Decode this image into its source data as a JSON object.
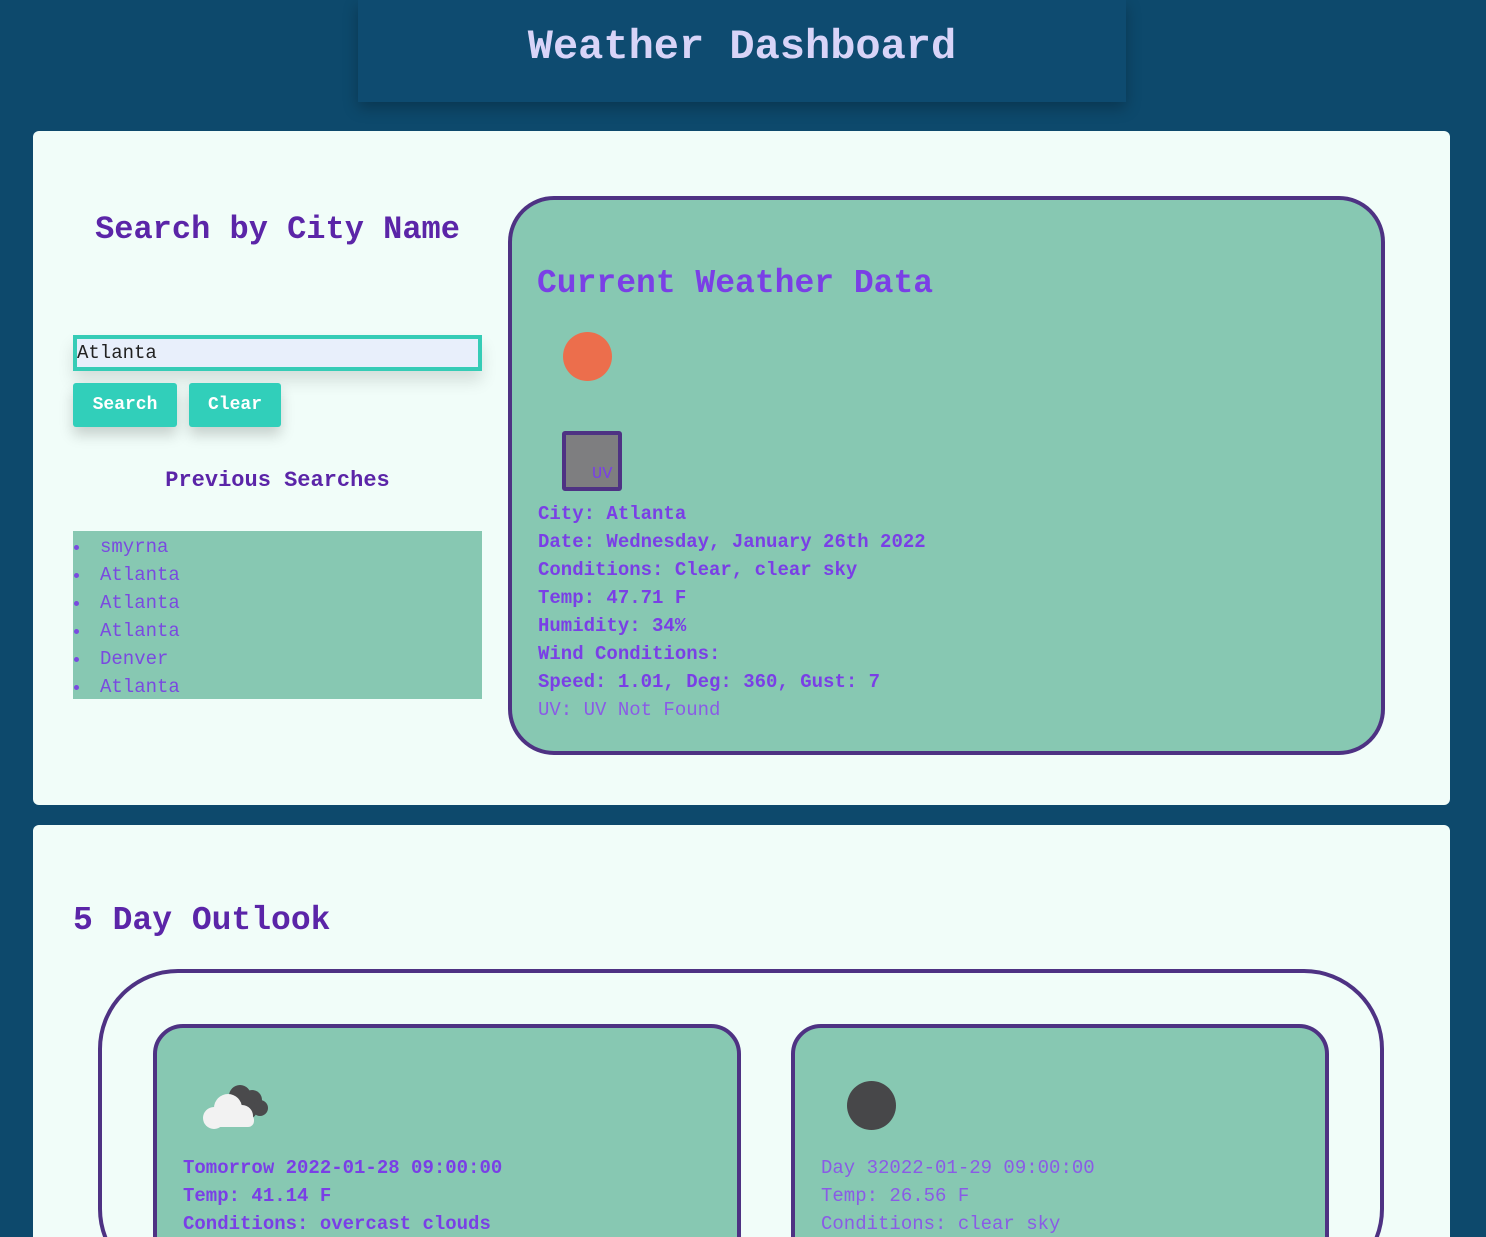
{
  "header": {
    "title": "Weather Dashboard"
  },
  "search": {
    "title": "Search by City Name",
    "input_value": "Atlanta",
    "search_label": "Search",
    "clear_label": "Clear",
    "previous_title": "Previous Searches",
    "previous": [
      "smyrna",
      "Atlanta",
      "Atlanta",
      "Atlanta",
      "Denver",
      "Atlanta"
    ]
  },
  "current": {
    "title": "Current Weather Data",
    "icon": "sun-icon",
    "uv_box_label": "UV",
    "city": "City: Atlanta",
    "date": "Date: Wednesday, January 26th 2022",
    "conditions": "Conditions: Clear, clear sky",
    "temp": "Temp: 47.71 F",
    "humidity": "Humidity: 34%",
    "wind_title": "Wind Conditions:",
    "wind": "Speed: 1.01, Deg: 360, Gust: 7",
    "uv": "UV: UV Not Found"
  },
  "outlook": {
    "title": "5 Day Outlook",
    "days": [
      {
        "icon": "cloud-icon",
        "heading": "Tomorrow 2022-01-28 09:00:00",
        "temp": "Temp: 41.14 F",
        "conditions": "Conditions: overcast clouds"
      },
      {
        "icon": "moon-icon",
        "heading": "Day 32022-01-29 09:00:00",
        "temp": "Temp: 26.56 F",
        "conditions": "Conditions: clear sky"
      }
    ]
  },
  "colors": {
    "background": "#0d496c",
    "panel": "#f1fdf9",
    "card": "#87c8b2",
    "accent": "#31cfba",
    "purple": "#7a3fe6",
    "border": "#4e3283"
  }
}
